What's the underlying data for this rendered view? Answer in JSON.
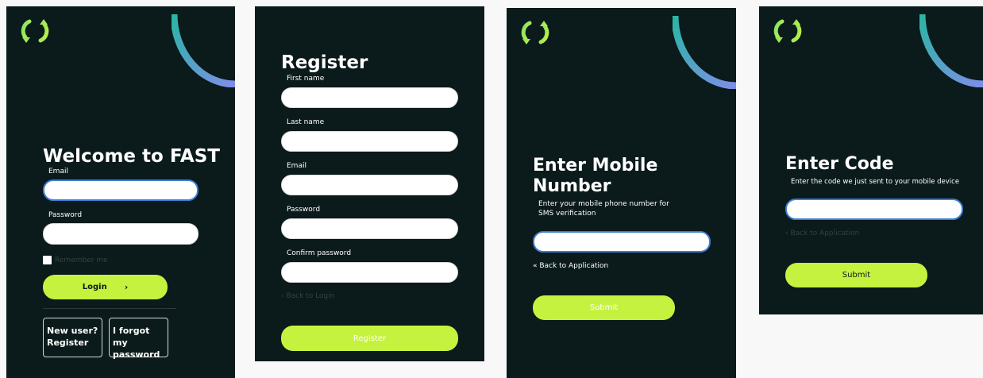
{
  "colors": {
    "panel_bg": "#0b1a1a",
    "accent_lime": "#c5f23f",
    "focus_blue": "#3b7fd6",
    "arc_start": "#2bb5a5",
    "arc_end": "#7e8ee8"
  },
  "login": {
    "title": "Welcome to FAST",
    "email_label": "Email",
    "password_label": "Password",
    "remember_label": "Remember me",
    "login_button": "Login",
    "new_user_line1": "New user?",
    "new_user_line2": "Register",
    "forgot_line1": "I forgot my",
    "forgot_line2": "password"
  },
  "register": {
    "title": "Register",
    "first_name_label": "First name",
    "last_name_label": "Last name",
    "email_label": "Email",
    "password_label": "Password",
    "confirm_label": "Confirm password",
    "back_link": "‹ Back to Login",
    "register_button": "Register"
  },
  "mobile": {
    "title_line1": "Enter Mobile",
    "title_line2": "Number",
    "description": "Enter your mobile phone number for SMS verification",
    "back_link": "« Back to Application",
    "submit_button": "Submit"
  },
  "code": {
    "title": "Enter Code",
    "description": "Enter the code we just sent to your mobile device",
    "back_link": "‹ Back to Application",
    "submit_button": "Submit"
  }
}
